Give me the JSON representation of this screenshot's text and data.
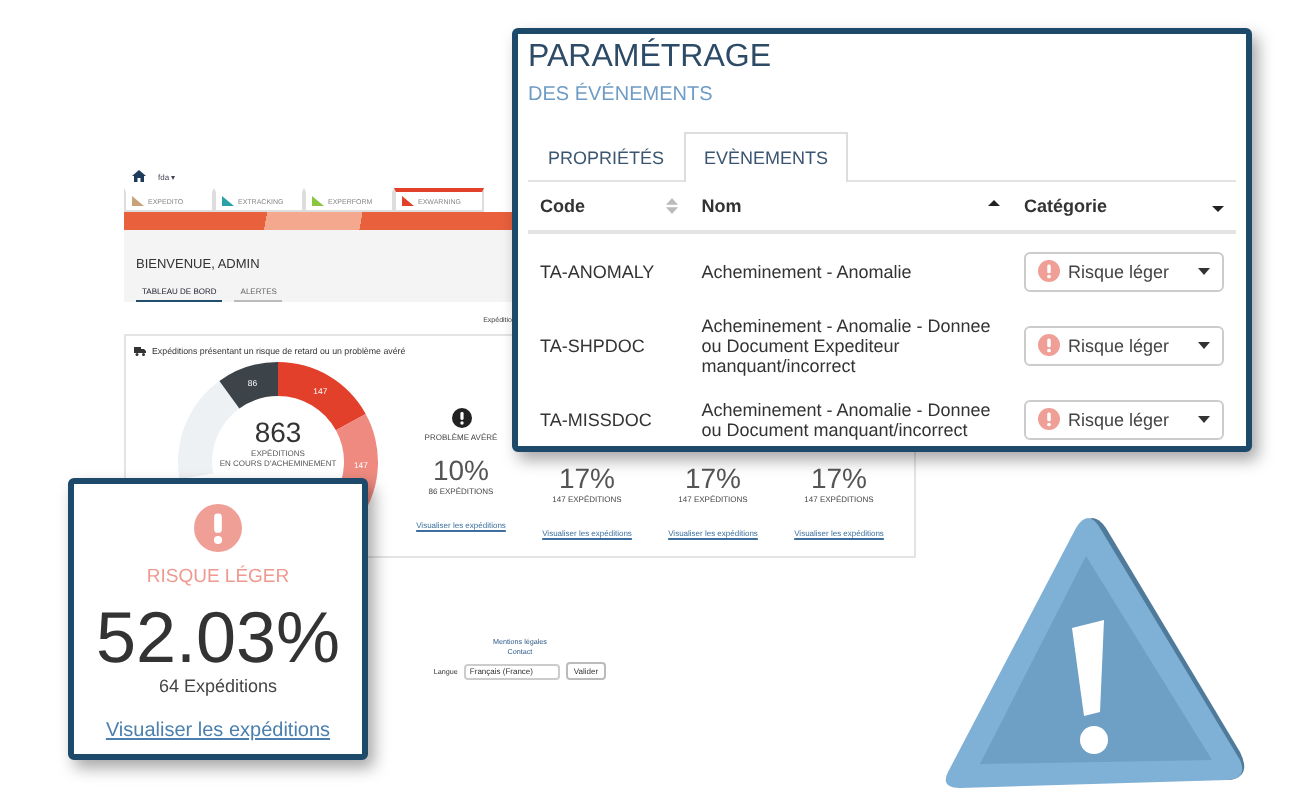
{
  "dashboard": {
    "user_menu": "fda ▾",
    "apps": [
      {
        "label": "EXPEDITO",
        "selected": false
      },
      {
        "label": "EXTRACKING",
        "selected": false
      },
      {
        "label": "EXPERFORM",
        "selected": false
      },
      {
        "label": "EXWARNING",
        "selected": true
      }
    ],
    "welcome": "BIENVENUE, ADMIN",
    "tabs": [
      {
        "label": "TABLEAU DE BORD",
        "selected": true
      },
      {
        "label": "ALERTES",
        "selected": false
      }
    ],
    "side_label": "Expéditio",
    "panel": {
      "title": "Expéditions présentant un risque de retard ou un problème avéré",
      "donut": {
        "total": "863",
        "caption": "EXPÉDITIONS",
        "sub_caption": "EN COURS D'ACHEMINEMENT",
        "segments": [
          {
            "label": "86",
            "color": "#3d4449"
          },
          {
            "label": "147",
            "color": "#e2402b"
          },
          {
            "label": "147",
            "color": "#ee8a7f"
          }
        ]
      },
      "stats": [
        {
          "label": "PROBLÈME AVÉRÉ",
          "percent": "10%",
          "count": "86 EXPÉDITIONS",
          "link": "Visualiser les expéditions"
        },
        {
          "percent": "17%",
          "count": "147 EXPÉDITIONS",
          "link": "Visualiser les expéditions"
        },
        {
          "percent": "17%",
          "count": "147 EXPÉDITIONS",
          "link": "Visualiser les expéditions"
        },
        {
          "percent": "17%",
          "count": "147 EXPÉDITIONS",
          "link": "Visualiser les expéditions"
        }
      ]
    }
  },
  "footer": {
    "links": [
      "Mentions légales",
      "Contact"
    ],
    "language_label": "Langue",
    "language_value": "Français (France)",
    "submit": "Valider"
  },
  "events_card": {
    "title": "PARAMÉTRAGE",
    "subtitle": "DES ÉVÉNEMENTS",
    "tabs": [
      {
        "label": "PROPRIÉTÉS",
        "selected": false
      },
      {
        "label": "EVÈNEMENTS",
        "selected": true
      }
    ],
    "columns": [
      {
        "label": "Code",
        "kind": "sortable"
      },
      {
        "label": "Nom",
        "kind": "sorted"
      },
      {
        "label": "Catégorie",
        "kind": "filter"
      }
    ],
    "rows": [
      {
        "code": "TA-ANOMALY",
        "name": "Acheminement - Anomalie",
        "category": "Risque léger"
      },
      {
        "code": "TA-SHPDOC",
        "name": "Acheminement - Anomalie - Donnee ou Document Expediteur manquant/incorrect",
        "category": "Risque léger"
      },
      {
        "code": "TA-MISSDOC",
        "name": "Acheminement - Anomalie - Donnee ou Document manquant/incorrect",
        "category": "Risque léger"
      }
    ]
  },
  "risk_card": {
    "label": "RISQUE LÉGER",
    "percent": "52.03%",
    "count": "64 Expéditions",
    "link": "Visualiser les expéditions"
  }
}
